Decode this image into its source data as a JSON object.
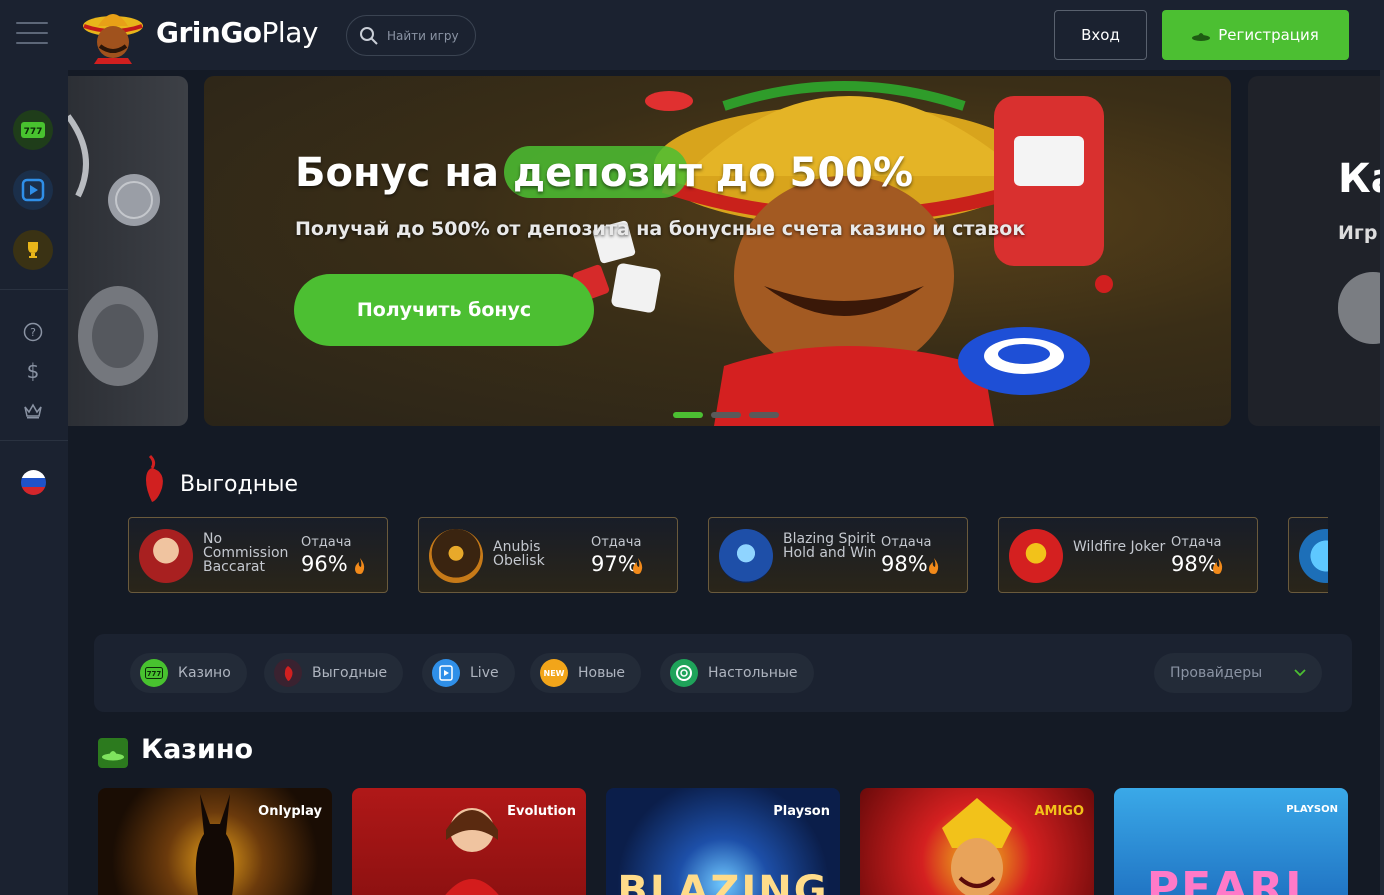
{
  "header": {
    "logo_bold": "GrinGo",
    "logo_light": "Play",
    "search_placeholder": "Найти игру",
    "login_label": "Вход",
    "register_label": "Регистрация"
  },
  "sidebar": {
    "icons": [
      "slot-777-icon",
      "live-play-icon",
      "trophy-icon",
      "help-icon",
      "dollar-icon",
      "crown-icon"
    ],
    "language": "ru"
  },
  "banner": {
    "title": "Бонус на депозит до 500%",
    "subtitle": "Получай до 500% от депозита на бонусные счета казино и ставок",
    "cta_label": "Получить бонус",
    "next_title": "Ка",
    "next_sub": "Игр",
    "slides_total": 3,
    "active_slide": 1
  },
  "profitable": {
    "title": "Выгодные",
    "return_label": "Отдача",
    "cards": [
      {
        "name": "No Commission Baccarat",
        "return": "96%"
      },
      {
        "name": "Anubis Obelisk",
        "return": "97%"
      },
      {
        "name": "Blazing Spirit Hold and Win",
        "return": "98%"
      },
      {
        "name": "Wildfire Joker",
        "return": "98%"
      }
    ]
  },
  "tabs": {
    "items": [
      {
        "label": "Казино",
        "icon": "slot-777-icon"
      },
      {
        "label": "Выгодные",
        "icon": "chili-icon"
      },
      {
        "label": "Live",
        "icon": "live-play-icon"
      },
      {
        "label": "Новые",
        "icon": "new-badge-icon",
        "badge": "NEW"
      },
      {
        "label": "Настольные",
        "icon": "roulette-icon"
      }
    ],
    "providers_label": "Провайдеры"
  },
  "casino": {
    "title": "Казино",
    "games": [
      {
        "provider": "Onlyplay",
        "logo": ""
      },
      {
        "provider": "Evolution",
        "logo": ""
      },
      {
        "provider": "Playson",
        "logo": "BLAZING"
      },
      {
        "provider": "AMIGO",
        "logo": ""
      },
      {
        "provider": "PLAYSON",
        "logo": "PEARL"
      }
    ]
  },
  "colors": {
    "accent_green": "#4cbf32",
    "header_bg": "#1b2230",
    "page_bg": "#141a25"
  }
}
